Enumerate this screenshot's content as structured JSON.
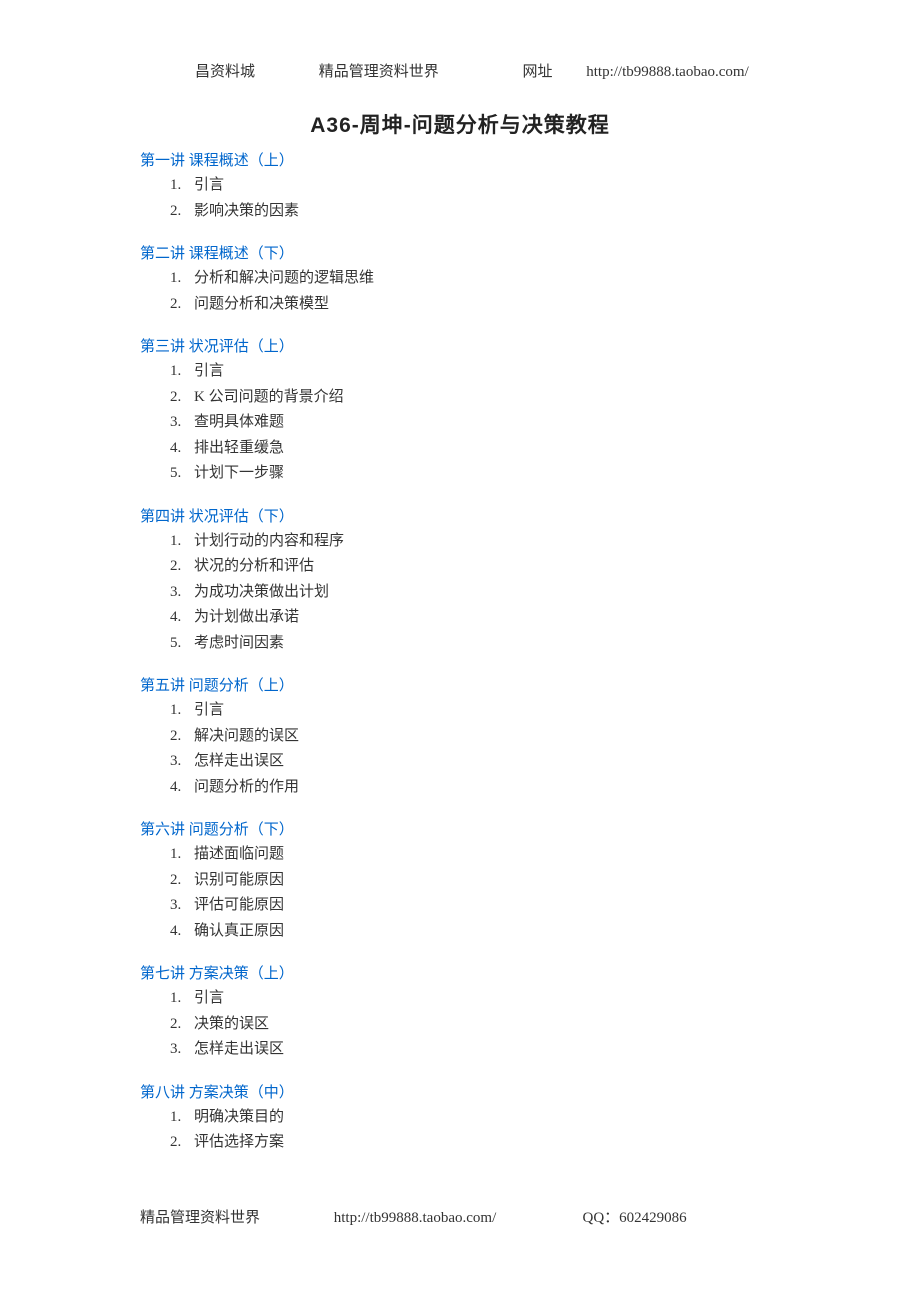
{
  "header": {
    "left": "昌资料城",
    "middle": "精品管理资料世界",
    "url_label": "网址",
    "url": "http://tb99888.taobao.com/"
  },
  "title": "A36-周坤-问题分析与决策教程",
  "sections": [
    {
      "heading": "第一讲  课程概述（上）",
      "items": [
        "引言",
        "影响决策的因素"
      ]
    },
    {
      "heading": "第二讲  课程概述（下）",
      "items": [
        "分析和解决问题的逻辑思维",
        "问题分析和决策模型"
      ]
    },
    {
      "heading": "第三讲  状况评估（上）",
      "items": [
        "引言",
        "K 公司问题的背景介绍",
        "查明具体难题",
        "排出轻重缓急",
        "计划下一步骤"
      ]
    },
    {
      "heading": "第四讲  状况评估（下）",
      "items": [
        "计划行动的内容和程序",
        "状况的分析和评估",
        "为成功决策做出计划",
        "为计划做出承诺",
        "考虑时间因素"
      ]
    },
    {
      "heading": "第五讲  问题分析（上）",
      "items": [
        "引言",
        "解决问题的误区",
        "怎样走出误区",
        "问题分析的作用"
      ]
    },
    {
      "heading": "第六讲  问题分析（下）",
      "items": [
        "描述面临问题",
        "识别可能原因",
        "评估可能原因",
        "确认真正原因"
      ]
    },
    {
      "heading": "第七讲  方案决策（上）",
      "items": [
        "引言",
        "决策的误区",
        "怎样走出误区"
      ]
    },
    {
      "heading": "第八讲  方案决策（中）",
      "items": [
        "明确决策目的",
        "评估选择方案"
      ]
    }
  ],
  "footer": {
    "left": "精品管理资料世界",
    "url": "http://tb99888.taobao.com/",
    "qq_label": "QQ：",
    "qq": "602429086"
  }
}
